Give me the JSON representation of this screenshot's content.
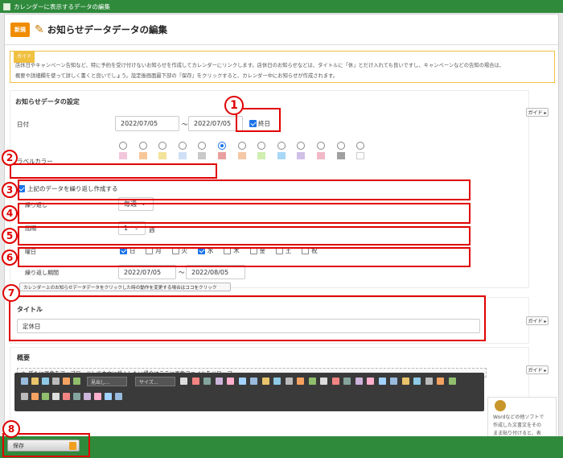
{
  "window": {
    "title": "カレンダーに表示するデータの編集"
  },
  "header": {
    "new_badge": "新規",
    "title": "お知らせデータデータの編集"
  },
  "guide": {
    "tag": "ガイド",
    "line1": "店休日やキャンペーン告知など、特に予約を受け付けないお知らせを作成してカレンダーにリンクします。店休日のお知らせなどは、タイトルに「休」とだけ入れても良いですし、キャンペーンなどの告知の場合は、",
    "line2": "概要や詳細欄を使って詳しく書くと良いでしょう。設定後画面最下部の『保存』をクリックすると、カレンダー中にお知らせが作成されます。"
  },
  "settings": {
    "title": "お知らせデータの設定",
    "guide_btn": "ガイド ▸",
    "date_label": "日付",
    "date_from": "2022/07/05",
    "tilde": "〜",
    "date_to": "2022/07/05",
    "allday_label": "終日",
    "allday_checked": true,
    "color_label": "ラベルカラー",
    "colors": [
      "#f4c6dc",
      "#f7c79a",
      "#f3e39a",
      "#cfe0f7",
      "#c9c9c9",
      "#e8a0a0",
      "#f5c8a8",
      "#cfeeb0",
      "#a8d8f5",
      "#d0c0e8",
      "#f0b8c8",
      "#a0a0a0",
      "#ffffff"
    ],
    "selected_color_index": 5,
    "repeat_label": "上記のデータを繰り返し作成する",
    "repeat_checked": true,
    "kurikaeshi_label": "繰り返し",
    "kurikaeshi_value": "毎週",
    "interval_label": "間隔",
    "interval_value": "1",
    "interval_unit": "週",
    "weekday_label": "曜日",
    "weekdays": [
      {
        "label": "日",
        "checked": true
      },
      {
        "label": "月",
        "checked": false
      },
      {
        "label": "火",
        "checked": false
      },
      {
        "label": "水",
        "checked": true
      },
      {
        "label": "木",
        "checked": false
      },
      {
        "label": "金",
        "checked": false
      },
      {
        "label": "土",
        "checked": false
      },
      {
        "label": "祝",
        "checked": false
      }
    ],
    "period_label": "繰り返し期間",
    "period_from": "2022/07/05",
    "period_tilde": "〜",
    "period_to": "2022/08/05",
    "click_note": "カレンダー上のお知らせデータデータをクリックした時の動作を変更する場合はココをクリック"
  },
  "title_section": {
    "label": "タイトル",
    "value": "定休日",
    "guide_btn": "ガイド ▸"
  },
  "summary_section": {
    "label": "概要",
    "guide_btn": "ガイド ▸",
    "drop_text": "新たに画像をアップロードして本文に挿入したい場合はここに画像ファイルをドロップ",
    "style_select": "見出し...",
    "size_select": "サイズ..."
  },
  "side_panel": {
    "line1": "Wordなどの他ソフトで",
    "line2": "作成した文書文をその",
    "line3": "まま貼り付けると、表"
  },
  "footer": {
    "save_label": "保存"
  },
  "markers": [
    "1",
    "2",
    "3",
    "4",
    "5",
    "6",
    "7",
    "8"
  ],
  "accent": "#2f8a3c",
  "highlight": "#e00000"
}
